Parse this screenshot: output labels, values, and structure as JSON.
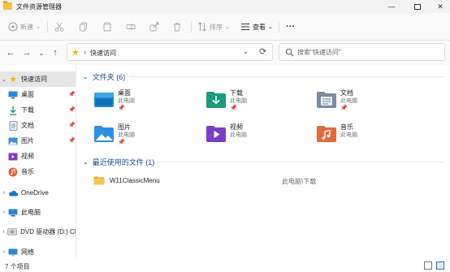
{
  "window": {
    "title": "文件资源管理器",
    "minimize": "—",
    "maximize_icon": "maximize-icon",
    "close": "✕"
  },
  "toolbar": {
    "new_label": "新建",
    "sort_label": "排序",
    "view_label": "查看",
    "more_label": "···"
  },
  "address": {
    "crumb": "快速访问",
    "search_placeholder": "搜索\"快速访问\""
  },
  "sidebar": {
    "items": [
      {
        "label": "快速访问",
        "icon": "star-icon"
      },
      {
        "label": "桌面",
        "icon": "desktop-icon"
      },
      {
        "label": "下载",
        "icon": "download-icon"
      },
      {
        "label": "文档",
        "icon": "documents-icon"
      },
      {
        "label": "图片",
        "icon": "pictures-icon"
      },
      {
        "label": "视频",
        "icon": "videos-icon"
      },
      {
        "label": "音乐",
        "icon": "music-icon"
      },
      {
        "label": "OneDrive",
        "icon": "cloud-icon"
      },
      {
        "label": "此电脑",
        "icon": "computer-icon"
      },
      {
        "label": "DVD 驱动器 (D:) CI",
        "icon": "dvd-icon"
      },
      {
        "label": "网络",
        "icon": "network-icon"
      }
    ]
  },
  "folders_section": {
    "title": "文件夹 (6)",
    "tiles": [
      {
        "name": "桌面",
        "sub": "此电脑",
        "icon": "desktop-folder-icon"
      },
      {
        "name": "下载",
        "sub": "此电脑",
        "icon": "download-folder-icon"
      },
      {
        "name": "文档",
        "sub": "此电脑",
        "icon": "documents-folder-icon"
      },
      {
        "name": "图片",
        "sub": "此电脑",
        "icon": "pictures-folder-icon"
      },
      {
        "name": "视频",
        "sub": "此电脑",
        "icon": "videos-folder-icon"
      },
      {
        "name": "音乐",
        "sub": "此电脑",
        "icon": "music-folder-icon"
      }
    ]
  },
  "recent_section": {
    "title": "最近使用的文件 (1)",
    "files": [
      {
        "name": "W11ClassicMenu",
        "path": "此电脑\\下载",
        "icon": "folder-icon"
      }
    ]
  },
  "status": {
    "count": "7 个项目"
  },
  "colors": {
    "accent": "#1a4d96",
    "selection": "#e6e6e6",
    "folder_yellow": "#f2c14e"
  }
}
